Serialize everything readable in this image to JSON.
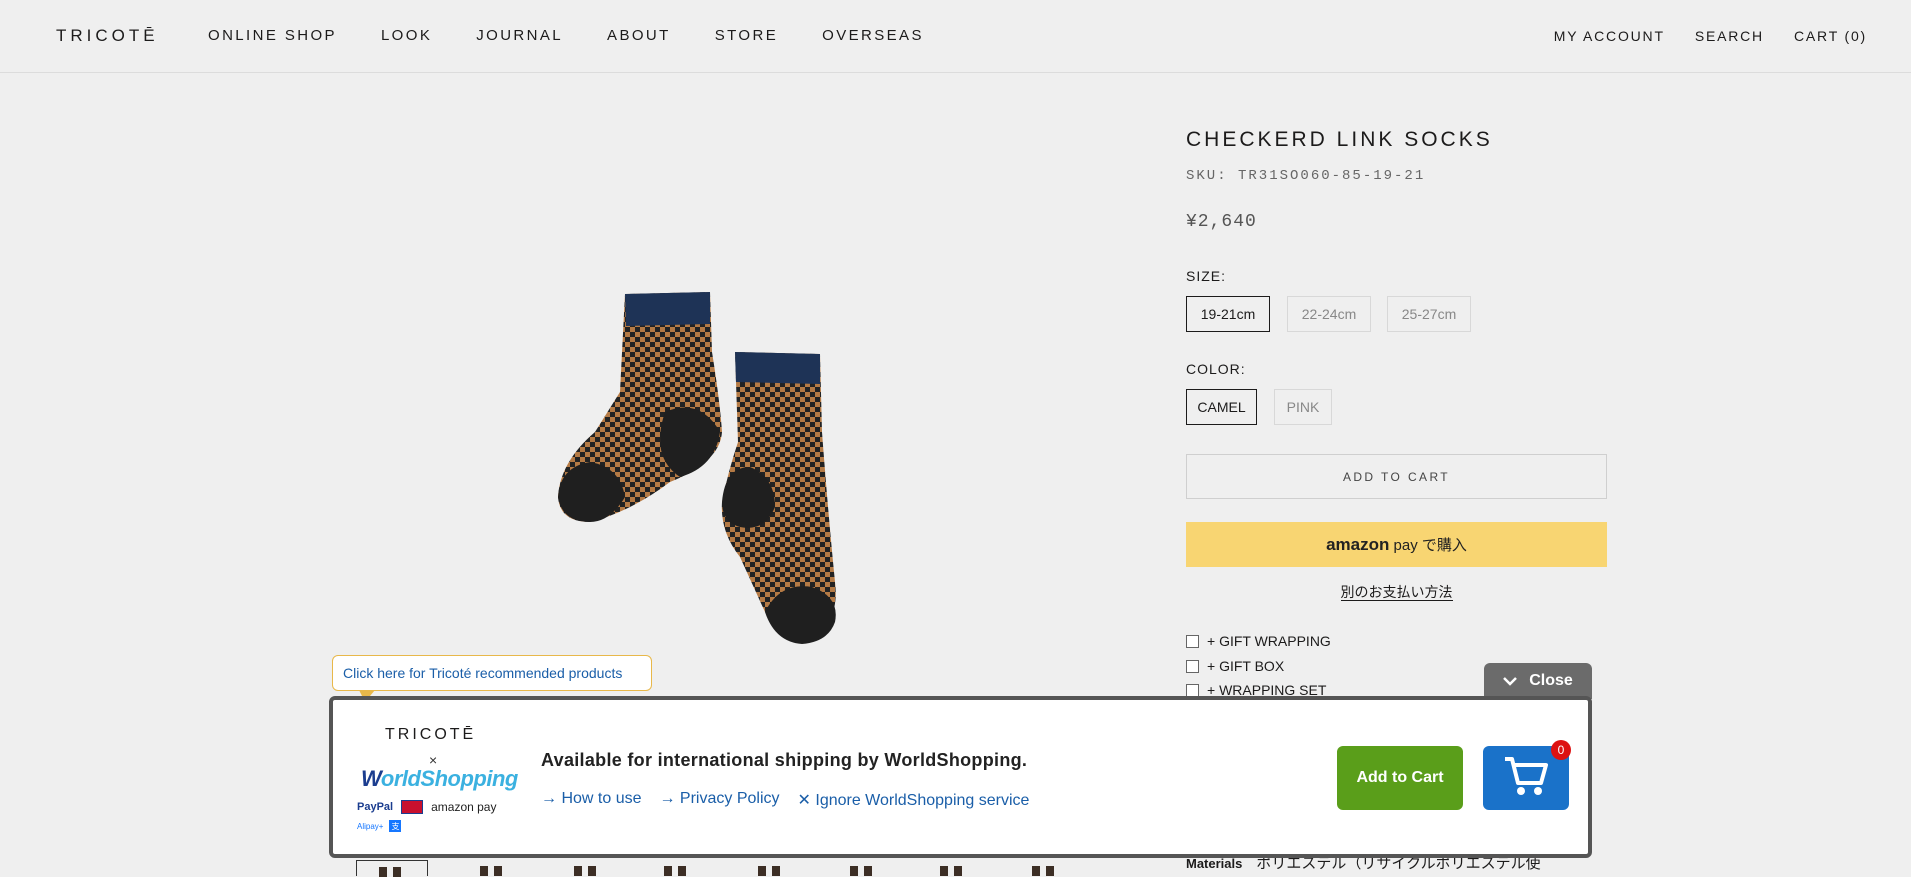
{
  "header": {
    "logo": "TRICOTĒ",
    "nav": [
      "ONLINE SHOP",
      "LOOK",
      "JOURNAL",
      "ABOUT",
      "STORE",
      "OVERSEAS"
    ],
    "account": "MY ACCOUNT",
    "search": "SEARCH",
    "cart": "CART (0)"
  },
  "product": {
    "title": "CHECKERD LINK SOCKS",
    "sku": "SKU: TR31SO060-85-19-21",
    "price": "¥2,640",
    "size_label": "SIZE:",
    "sizes": [
      "19-21cm",
      "22-24cm",
      "25-27cm"
    ],
    "selected_size": "19-21cm",
    "color_label": "COLOR:",
    "colors": [
      "CAMEL",
      "PINK"
    ],
    "selected_color": "CAMEL",
    "add_to_cart": "ADD TO CART",
    "amazon_pay_brand": "amazon",
    "amazon_pay_suffix": "pay で購入",
    "alt_payment": "別のお支払い方法",
    "options": [
      "+ GIFT WRAPPING",
      "+ GIFT BOX",
      "+ WRAPPING SET"
    ],
    "materials_label": "Materials",
    "materials_value": "ポリエステル（リサイクルポリエステル使"
  },
  "tooltip": "Click here for Tricoté recommended products",
  "worldshopping": {
    "close": "Close",
    "shop_logo": "TRICOTĒ",
    "times": "×",
    "brand_w": "W",
    "brand_rest": "orldShopping",
    "paypal": "PayPal",
    "amazonpay": "amazon pay",
    "alipay": "Alipay+",
    "message": "Available for international shipping by WorldShopping.",
    "links": [
      "→ How to use",
      "→ Privacy Policy",
      "✕ Ignore WorldShopping service"
    ],
    "add_to_cart": "Add to Cart",
    "cart_count": "0"
  },
  "colors": {
    "amazon_yellow": "#f8d572",
    "ws_green": "#5a9e1a",
    "ws_blue": "#1a72c9",
    "tooltip_border": "#e8b84a"
  }
}
